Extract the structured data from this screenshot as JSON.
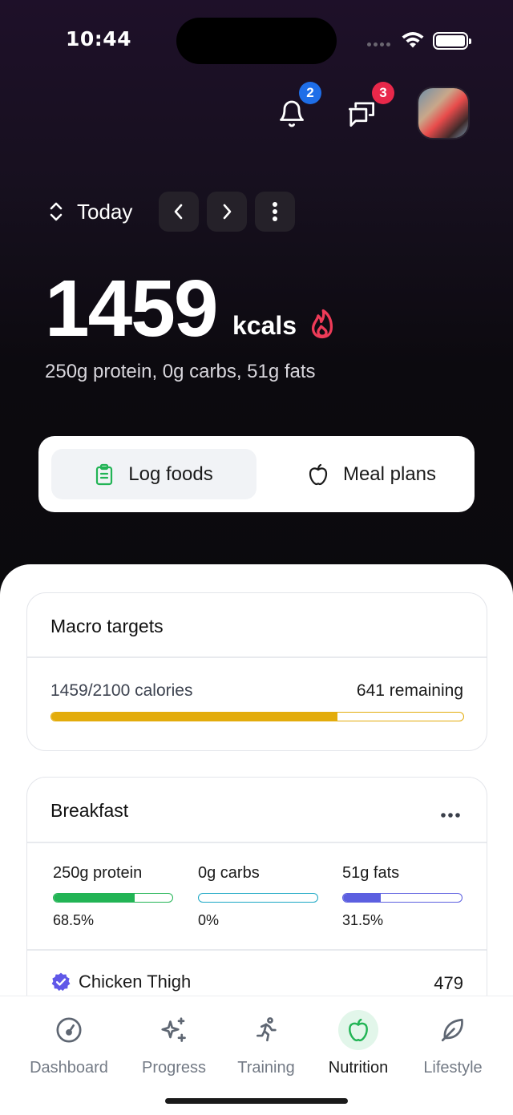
{
  "status": {
    "time": "10:44"
  },
  "header": {
    "notifications_count": "2",
    "messages_count": "3",
    "badge_colors": {
      "notifications": "#1e6ee8",
      "messages": "#e8284a"
    }
  },
  "date_nav": {
    "label": "Today"
  },
  "summary": {
    "calories": "1459",
    "unit": "kcals",
    "macros_line": "250g protein, 0g carbs, 51g fats"
  },
  "segment": {
    "items": [
      {
        "label": "Log foods",
        "icon": "clipboard-icon",
        "selected": true
      },
      {
        "label": "Meal plans",
        "icon": "apple-icon",
        "selected": false
      }
    ]
  },
  "macro_targets": {
    "title": "Macro targets",
    "calories_text": "1459/2100 calories",
    "remaining_text": "641 remaining",
    "progress": 0.695,
    "color": "#e3ac0c"
  },
  "breakfast": {
    "title": "Breakfast",
    "macros": [
      {
        "label": "250g protein",
        "percent": "68.5%",
        "fill": 0.685,
        "color": "#22b455"
      },
      {
        "label": "0g carbs",
        "percent": "0%",
        "fill": 0.0,
        "color": "#1aa7c4"
      },
      {
        "label": "51g fats",
        "percent": "31.5%",
        "fill": 0.315,
        "color": "#5c5fe0"
      }
    ],
    "items": [
      {
        "name": "Chicken Thigh",
        "calories": "479"
      }
    ]
  },
  "tabbar": {
    "tabs": [
      {
        "label": "Dashboard",
        "icon": "gauge-icon"
      },
      {
        "label": "Progress",
        "icon": "sparkles-icon"
      },
      {
        "label": "Training",
        "icon": "running-icon"
      },
      {
        "label": "Nutrition",
        "icon": "apple-icon",
        "active": true
      },
      {
        "label": "Lifestyle",
        "icon": "leaf-icon"
      }
    ]
  }
}
